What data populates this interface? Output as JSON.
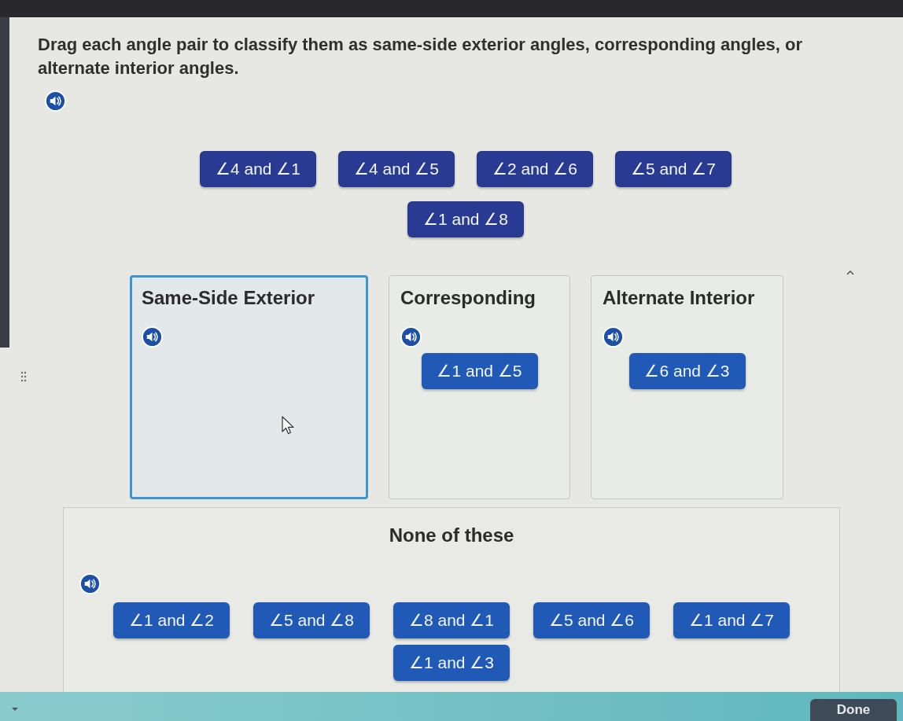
{
  "instructions": "Drag each angle pair to classify them as same-side exterior angles, corresponding angles, or alternate interior angles.",
  "answer_bank": [
    "∠4 and ∠1",
    "∠4 and ∠5",
    "∠2 and ∠6",
    "∠5 and ∠7",
    "∠1 and ∠8"
  ],
  "categories": [
    {
      "title": "Same-Side Exterior",
      "highlighted": true
    },
    {
      "title": "Corresponding",
      "highlighted": false,
      "tiles": [
        "∠1 and ∠5"
      ]
    },
    {
      "title": "Alternate Interior",
      "highlighted": false,
      "tiles": [
        "∠6 and ∠3"
      ]
    }
  ],
  "none_of_these": {
    "title": "None of these",
    "tiles": [
      "∠1 and ∠2",
      "∠5 and ∠8",
      "∠8 and ∠1",
      "∠5 and ∠6",
      "∠1 and ∠7",
      "∠1 and ∠3"
    ]
  },
  "done_button": "Done"
}
